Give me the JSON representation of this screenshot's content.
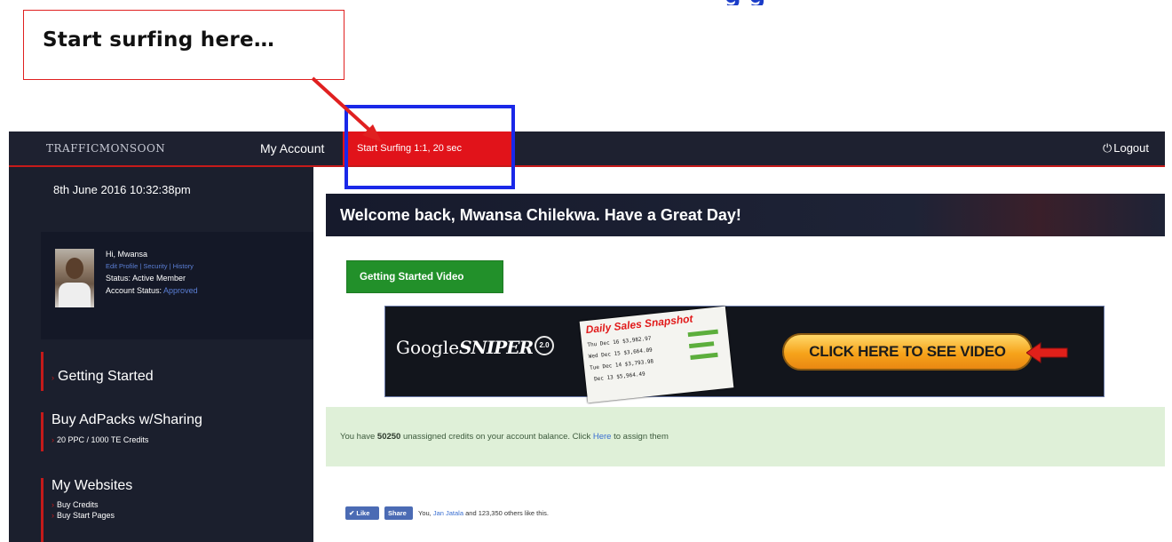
{
  "annotation": {
    "callout_text": "Start surfing here…",
    "heading_fragment": "g       g"
  },
  "topbar": {
    "logo": "TRAFFICMONSOON",
    "my_account": "My Account",
    "start_surfing": "Start Surfing 1:1, 20 sec",
    "logout": "Logout"
  },
  "sidebar": {
    "datetime": "8th June 2016 10:32:38pm",
    "profile": {
      "greeting": "Hi, Mwansa",
      "links": "Edit Profile | Security | History",
      "status": "Status: Active Member",
      "account_status_label": "Account Status: ",
      "account_status_value": "Approved"
    },
    "sections": [
      {
        "title": "Getting Started",
        "items": []
      },
      {
        "title": "Buy AdPacks w/Sharing",
        "items": [
          "20 PPC / 1000 TE Credits"
        ]
      },
      {
        "title": "My Websites",
        "items": [
          "Buy Credits",
          "Buy Start Pages"
        ]
      }
    ]
  },
  "main": {
    "welcome": "Welcome back, Mwansa Chilekwa. Have a Great Day!",
    "getting_started_button": "Getting Started Video",
    "banner": {
      "brand_a": "Google",
      "brand_b": "SNIPER",
      "version": "2.0",
      "snapshot_title": "Daily Sales Snapshot",
      "rows": [
        {
          "day": "Thu",
          "date": "Dec 16",
          "amount": "$3,982.97"
        },
        {
          "day": "Wed",
          "date": "Dec 15",
          "amount": "$3,664.09"
        },
        {
          "day": "Tue",
          "date": "Dec 14",
          "amount": "$3,793.98"
        },
        {
          "day": "",
          "date": "Dec 13",
          "amount": "$5,964.49"
        }
      ],
      "cta": "CLICK HERE TO SEE VIDEO"
    },
    "credits": {
      "prefix": "You have ",
      "amount": "50250",
      "middle": " unassigned credits on your account balance. Click ",
      "link": "Here",
      "suffix": " to assign them"
    },
    "social": {
      "like": "Like",
      "share": "Share",
      "text_prefix": "You, ",
      "friend": "Jan Jatala",
      "text_suffix": " and 123,350 others like this."
    }
  },
  "colors": {
    "accent_red": "#e1131a",
    "nav_bg": "#1e2130",
    "highlight_blue": "#1a28e8",
    "success_green": "#22902a",
    "alert_bg": "#dff0d8"
  }
}
